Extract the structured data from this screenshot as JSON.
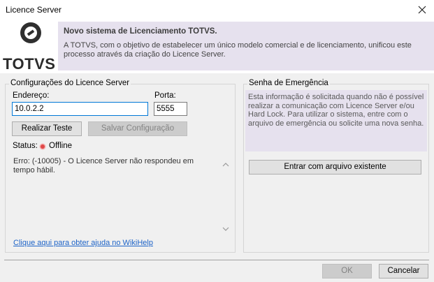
{
  "window": {
    "title": "Licence Server",
    "close_icon": "close-icon"
  },
  "banner": {
    "logo_text": "TOTVS",
    "title": "Novo sistema de Licenciamento TOTVS.",
    "description": "A TOTVS, com o objetivo de estabelecer um único modelo comercial e de licenciamento, unificou este processo através da criação do Licence Server."
  },
  "config": {
    "legend": "Configurações do Licence Server",
    "address_label": "Endereço:",
    "address_value": "10.0.2.2",
    "port_label": "Porta:",
    "port_value": "5555",
    "test_button": "Realizar Teste",
    "save_button": "Salvar Configuração",
    "status_label": "Status:",
    "status_value": "Offline",
    "status_color": "#e04848",
    "log_text": "Erro: (-10005) - O Licence Server não respondeu em tempo hábil.",
    "help_link": "Clique aqui para obter ajuda no WikiHelp"
  },
  "emergency": {
    "legend": "Senha de Emergência",
    "info": "Esta informação é solicitada quando não é possível realizar a comunicação com Licence Server e/ou Hard Lock. Para utilizar o sistema, entre com o arquivo de emergência ou solicite uma nova senha.",
    "file_button": "Entrar com arquivo existente"
  },
  "footer": {
    "ok_button": "OK",
    "cancel_button": "Cancelar"
  }
}
